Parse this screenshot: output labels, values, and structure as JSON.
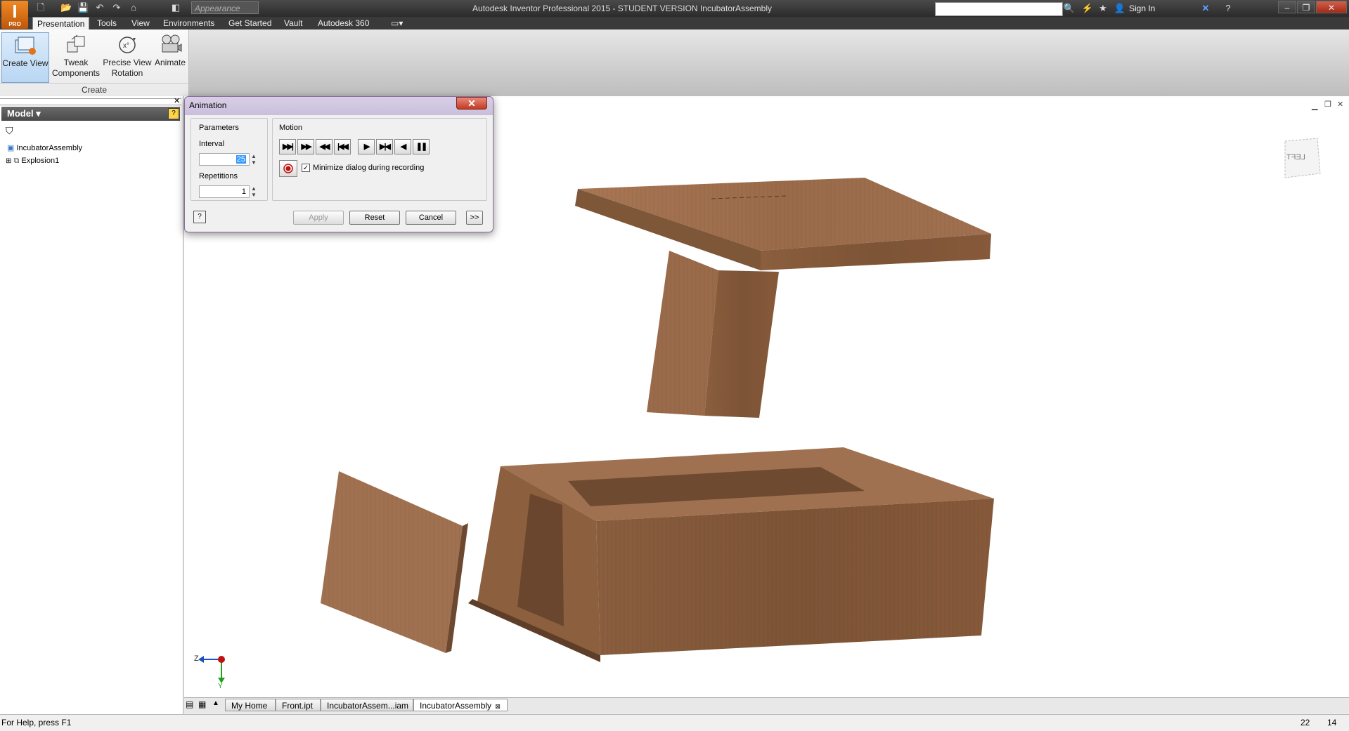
{
  "app": {
    "logo_letter": "I",
    "logo_sub": "PRO",
    "window_title": "Autodesk Inventor Professional 2015 - STUDENT VERSION   IncubatorAssembly",
    "appearance_placeholder": "Appearance",
    "sign_in": "Sign In"
  },
  "ribbon": {
    "tabs": [
      "Presentation",
      "Tools",
      "View",
      "Environments",
      "Get Started",
      "Vault",
      "Autodesk 360"
    ],
    "buttons": {
      "create_view": "Create View",
      "tweak_1": "Tweak",
      "tweak_2": "Components",
      "precise_1": "Precise View",
      "precise_2": "Rotation",
      "animate": "Animate"
    },
    "panel_label": "Create"
  },
  "browser": {
    "header": "Model",
    "items": [
      "IncubatorAssembly",
      "Explosion1"
    ]
  },
  "viewcube": {
    "label": "LEFT"
  },
  "triad": {
    "z": "Z",
    "y": "Y"
  },
  "dialog": {
    "title": "Animation",
    "parameters_label": "Parameters",
    "interval_label": "Interval",
    "interval_value": "25",
    "repetitions_label": "Repetitions",
    "repetitions_value": "1",
    "motion_label": "Motion",
    "minimize_label": "Minimize dialog during recording",
    "minimize_checked": true,
    "apply": "Apply",
    "reset": "Reset",
    "cancel": "Cancel",
    "more": ">>"
  },
  "doc_tabs": [
    "My Home",
    "Front.ipt",
    "IncubatorAssem...iam",
    "IncubatorAssembly"
  ],
  "status": {
    "help": "For Help, press F1",
    "count1": "22",
    "count2": "14"
  },
  "colors": {
    "wood_light": "#a0714f",
    "wood_mid": "#8a5e3e",
    "wood_dark": "#6f4a30",
    "accent_orange": "#e0741a"
  }
}
